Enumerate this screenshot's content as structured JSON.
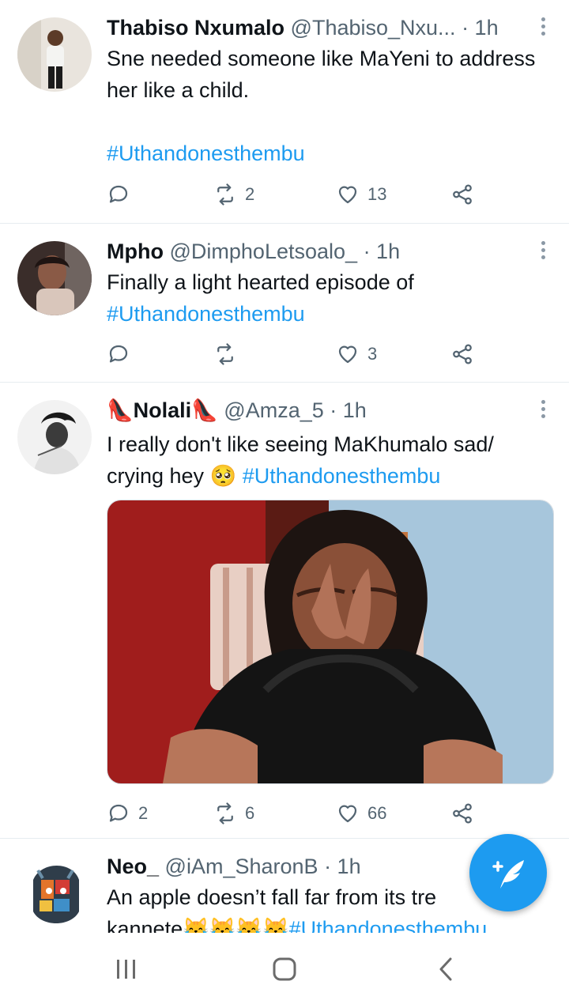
{
  "tweets": [
    {
      "name": "Thabiso Nxumalo",
      "handle": "@Thabiso_Nxu...",
      "time": "· 1h",
      "text": "Sne needed someone like MaYeni to address her like a child.",
      "hashtag": "#Uthandonesthembu",
      "replies": "",
      "retweets": "2",
      "likes": "13"
    },
    {
      "name": "Mpho",
      "handle": "@DimphoLetsoalo_",
      "time": "· 1h",
      "text": "Finally a light hearted episode of",
      "hashtag": "#Uthandonesthembu",
      "replies": "",
      "retweets": "",
      "likes": "3"
    },
    {
      "name": "Nolali",
      "name_emoji": "👠",
      "handle": "@Amza_5",
      "time": "· 1h",
      "text_line1": "I really don't like seeing MaKhumalo sad/",
      "text_line2": "crying hey",
      "emoji": "🥺",
      "hashtag": "#Uthandonesthembu",
      "replies": "2",
      "retweets": "6",
      "likes": "66"
    },
    {
      "name": "Neo_",
      "handle": "@iAm_SharonB",
      "time": "· 1h",
      "text_line1": "An apple doesn’t fall far from its tre",
      "text_line2": "kannete",
      "emoji": "😹😹😹😹",
      "hashtag": "#Uthandonesthembu"
    }
  ],
  "colors": {
    "accent": "#1d9bf0",
    "muted": "#536471",
    "divider": "#e6ecf0"
  },
  "icons": {
    "reply": "reply-icon",
    "retweet": "retweet-icon",
    "like": "heart-icon",
    "share": "share-icon",
    "compose": "compose-tweet-icon",
    "nav_recents": "recents-icon",
    "nav_home": "home-icon",
    "nav_back": "back-icon"
  }
}
